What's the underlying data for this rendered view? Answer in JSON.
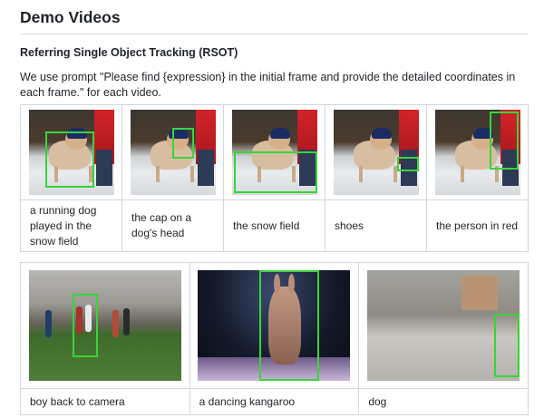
{
  "heading": "Demo Videos",
  "section_title": "Referring Single Object Tracking (RSOT)",
  "description": "We use prompt \"Please find {expression} in the initial frame and provide the detailed coordinates in each frame.\" for each video.",
  "rsot_examples_row1": [
    {
      "caption": "a running dog played in the snow field"
    },
    {
      "caption": "the cap on a dog's head"
    },
    {
      "caption": "the snow field"
    },
    {
      "caption": "shoes"
    },
    {
      "caption": "the person in red"
    }
  ],
  "rsot_examples_row2": [
    {
      "caption": "boy back to camera"
    },
    {
      "caption": "a dancing kangaroo"
    },
    {
      "caption": "dog"
    }
  ],
  "colors": {
    "bbox": "#39d43a",
    "border": "#d0d7de",
    "text": "#1f2328"
  }
}
